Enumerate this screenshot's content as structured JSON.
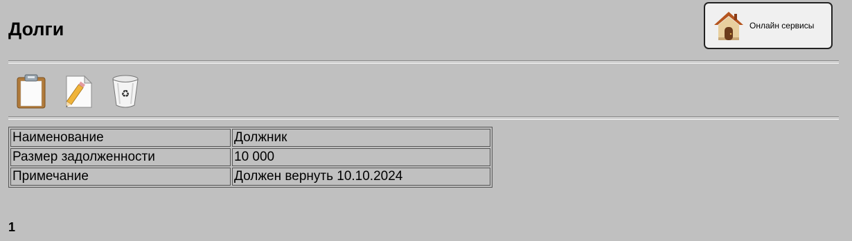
{
  "header": {
    "title": "Долги",
    "online_services_label": "Онлайн сервисы"
  },
  "toolbar": {
    "icons": [
      "clipboard-icon",
      "edit-document-icon",
      "recycle-bin-icon"
    ]
  },
  "details": {
    "rows": [
      {
        "label": "Наименование",
        "value": "Должник"
      },
      {
        "label": "Размер задолженности",
        "value": "10 000"
      },
      {
        "label": "Примечание",
        "value": "Должен вернуть 10.10.2024"
      }
    ]
  },
  "pagination": {
    "current_page": "1"
  },
  "colors": {
    "background": "#c0c0c0",
    "button_background": "#f0f0f0"
  }
}
